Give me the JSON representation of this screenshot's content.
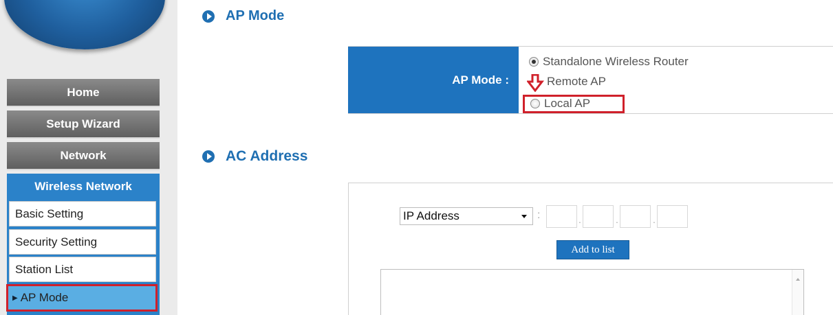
{
  "sidebar": {
    "nav": {
      "home": "Home",
      "setup_wizard": "Setup Wizard",
      "network": "Network",
      "wireless_network": "Wireless Network"
    },
    "wireless_items": {
      "basic_setting": "Basic Setting",
      "security_setting": "Security Setting",
      "station_list": "Station List",
      "ap_mode": "AP Mode"
    },
    "active_item": "AP Mode"
  },
  "ap_mode_section": {
    "title": "AP Mode",
    "field_label": "AP Mode :",
    "options": {
      "standalone": "Standalone Wireless Router",
      "remote": "Remote AP",
      "local": "Local AP"
    },
    "selected": "Standalone Wireless Router",
    "highlighted_option": "Local AP"
  },
  "ac_address_section": {
    "title": "AC Address",
    "address_type": "IP Address",
    "separator": ":",
    "octets": [
      "",
      "",
      "",
      ""
    ],
    "add_button": "Add to list"
  },
  "colors": {
    "accent_blue": "#1e73be",
    "highlight_red": "#d0202a",
    "nav_gray": "#6e6e6e"
  },
  "icons": {
    "section_bullet": "circle-arrow-icon",
    "annotation_arrow": "red-down-arrow-icon"
  }
}
